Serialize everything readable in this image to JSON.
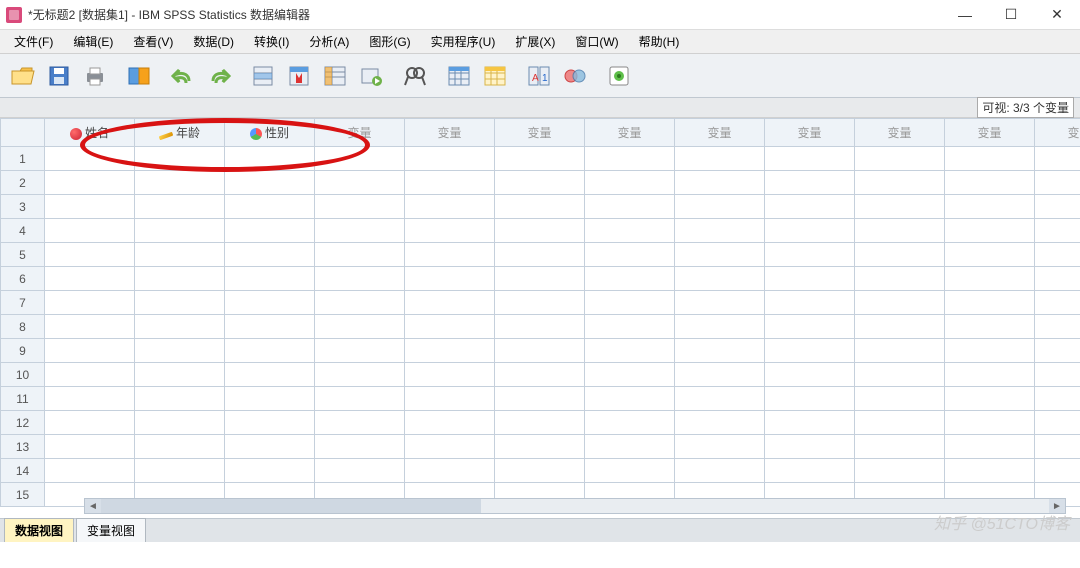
{
  "title": "*无标题2 [数据集1] - IBM SPSS Statistics 数据编辑器",
  "window_controls": {
    "min": "—",
    "max": "☐",
    "close": "✕"
  },
  "menus": [
    "文件(F)",
    "编辑(E)",
    "查看(V)",
    "数据(D)",
    "转换(I)",
    "分析(A)",
    "图形(G)",
    "实用程序(U)",
    "扩展(X)",
    "窗口(W)",
    "帮助(H)"
  ],
  "toolbar_icons": [
    "open",
    "save",
    "print",
    "sep",
    "recall",
    "sep",
    "undo",
    "redo",
    "sep",
    "goto-case",
    "goto-var",
    "variables",
    "sep",
    "find",
    "sep",
    "insert-case",
    "insert-var",
    "split",
    "weight",
    "sep",
    "value-labels",
    "use-sets",
    "sep",
    "show-all"
  ],
  "visible_label": "可视: 3/3 个变量",
  "columns": [
    {
      "name": "姓名",
      "icon": "string"
    },
    {
      "name": "年龄",
      "icon": "scale"
    },
    {
      "name": "性别",
      "icon": "nominal"
    }
  ],
  "placeholder_col": "变量",
  "placeholder_cols_count": 9,
  "row_count": 15,
  "tabs": {
    "data_view": "数据视图",
    "variable_view": "变量视图"
  },
  "watermark": "知乎 @51CTO博客"
}
